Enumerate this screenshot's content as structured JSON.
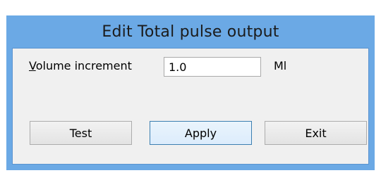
{
  "window": {
    "title": "Edit Total pulse output"
  },
  "form": {
    "volume_label_access_key": "V",
    "volume_label_rest": "olume increment",
    "volume_value": "1.0",
    "unit": "Ml"
  },
  "buttons": {
    "test": "Test",
    "apply": "Apply",
    "exit": "Exit"
  },
  "colors": {
    "frame": "#6ba9e5",
    "client": "#f0f0f0",
    "default_button_border": "#3c7fb1"
  }
}
